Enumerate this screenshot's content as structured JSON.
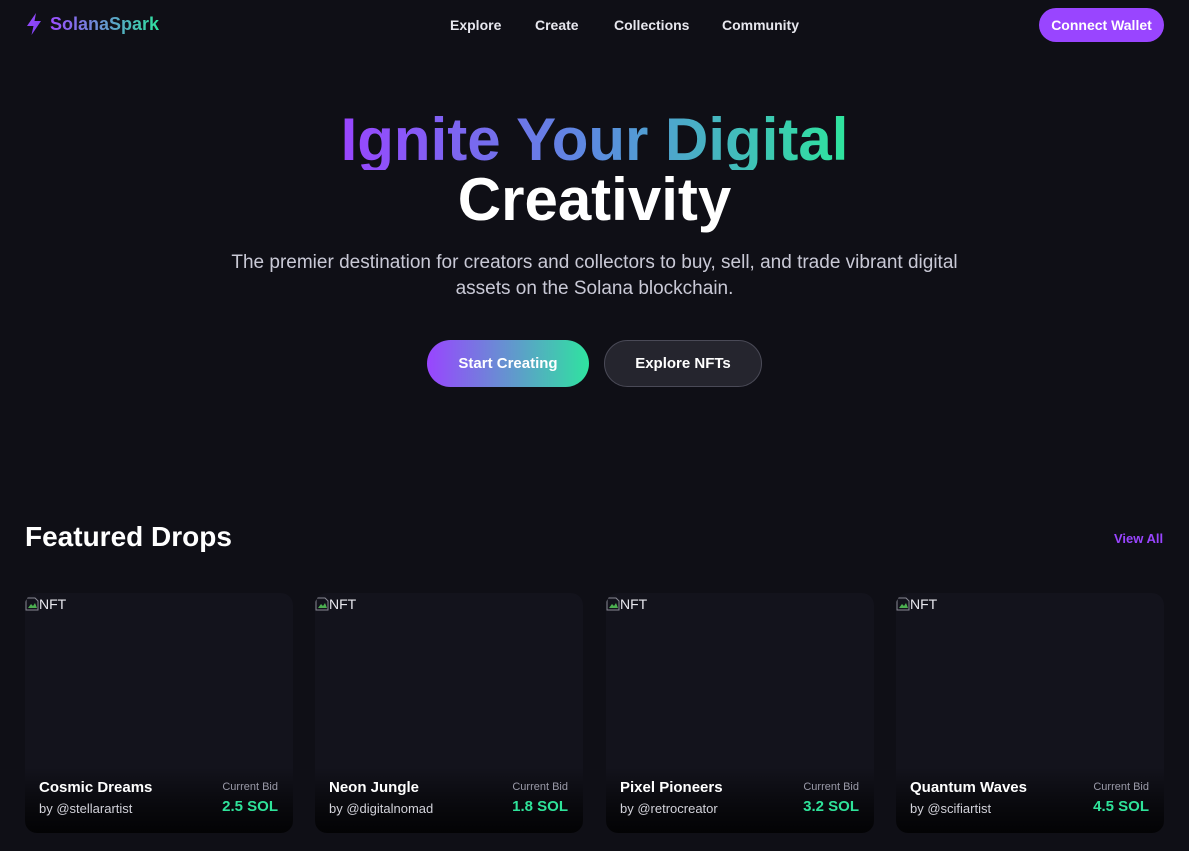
{
  "nav": {
    "brand": "SolanaSpark",
    "links": [
      "Explore",
      "Create",
      "Collections",
      "Community"
    ],
    "connect_label": "Connect Wallet"
  },
  "hero": {
    "title_gradient": "Ignite Your Digital",
    "title_plain": "Creativity",
    "subtitle": "The premier destination for creators and collectors to buy, sell, and trade vibrant digital assets on the Solana blockchain.",
    "primary_cta": "Start Creating",
    "secondary_cta": "Explore NFTs"
  },
  "featured": {
    "title": "Featured Drops",
    "view_all": "View All",
    "cards": [
      {
        "image_alt": "NFT",
        "name": "Cosmic Dreams",
        "creator": "by @stellarartist",
        "bid_label": "Current Bid",
        "bid": "2.5 SOL"
      },
      {
        "image_alt": "NFT",
        "name": "Neon Jungle",
        "creator": "by @digitalnomad",
        "bid_label": "Current Bid",
        "bid": "1.8 SOL"
      },
      {
        "image_alt": "NFT",
        "name": "Pixel Pioneers",
        "creator": "by @retrocreator",
        "bid_label": "Current Bid",
        "bid": "3.2 SOL"
      },
      {
        "image_alt": "NFT",
        "name": "Quantum Waves",
        "creator": "by @scifiartist",
        "bid_label": "Current Bid",
        "bid": "4.5 SOL"
      }
    ]
  },
  "colors": {
    "background": "#0f0f16",
    "accent_purple": "#9945ff",
    "accent_green": "#2fe39a"
  }
}
